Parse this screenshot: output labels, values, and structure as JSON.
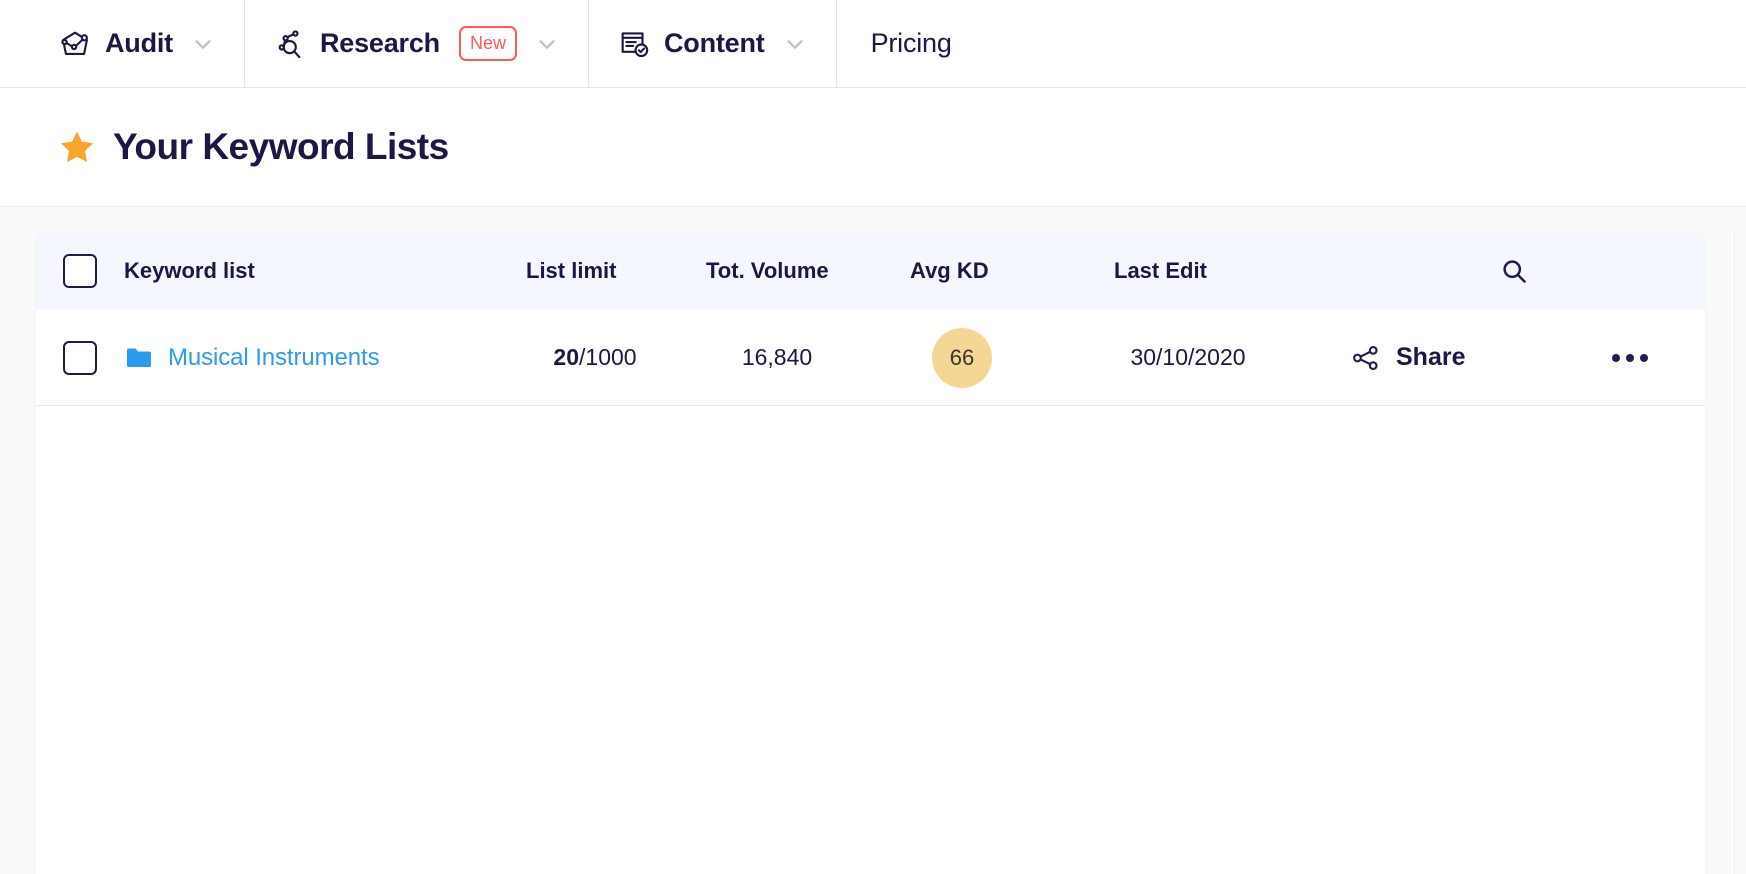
{
  "nav": {
    "items": [
      {
        "label": "Audit",
        "icon": "audit-icon",
        "has_chevron": true,
        "badge": null,
        "bold": true
      },
      {
        "label": "Research",
        "icon": "research-icon",
        "has_chevron": true,
        "badge": "New",
        "bold": true
      },
      {
        "label": "Content",
        "icon": "content-icon",
        "has_chevron": true,
        "badge": null,
        "bold": true
      },
      {
        "label": "Pricing",
        "icon": null,
        "has_chevron": false,
        "badge": null,
        "bold": false
      }
    ]
  },
  "page": {
    "title": "Your Keyword Lists",
    "title_icon": "star-icon"
  },
  "table": {
    "columns": {
      "keyword_list": "Keyword list",
      "list_limit": "List limit",
      "total_volume": "Tot. Volume",
      "avg_kd": "Avg KD",
      "last_edit": "Last Edit"
    },
    "search_icon": "search-icon",
    "rows": [
      {
        "name": "Musical Instruments",
        "limit_used": "20",
        "limit_total": "/1000",
        "total_volume": "16,840",
        "avg_kd": "66",
        "last_edit": "30/10/2020",
        "share_label": "Share"
      }
    ]
  },
  "colors": {
    "navy": "#1c1843",
    "link_blue": "#2b9af3",
    "badge_red": "#fb5b5b",
    "kd_amber": "#f5d795",
    "star_orange": "#f7a52b",
    "header_bg": "#f4f7fd"
  }
}
